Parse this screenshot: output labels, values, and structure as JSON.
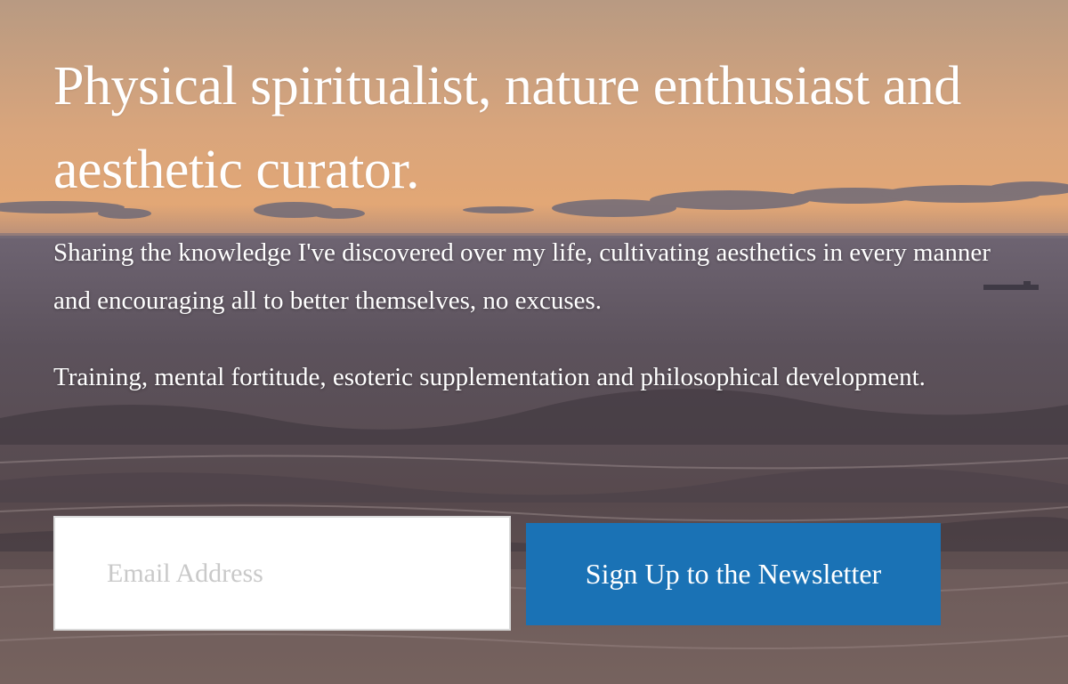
{
  "hero": {
    "headline": "Physical spiritualist, nature enthusiast and aesthetic curator.",
    "paragraph_1": "Sharing the knowledge I've discovered over my life, cultivating aesthetics in every manner and encouraging all to better themselves, no excuses.",
    "paragraph_2": "Training, mental fortitude, esoteric supplementation and philosophical development."
  },
  "newsletter": {
    "email_placeholder": "Email Address",
    "email_value": "",
    "button_label": "Sign Up to the Newsletter"
  },
  "colors": {
    "button": "#1a72b5",
    "text": "#ffffff",
    "sky_top": "#b89a80",
    "sky_glow": "#e8a470",
    "sea": "#5a4f55"
  }
}
